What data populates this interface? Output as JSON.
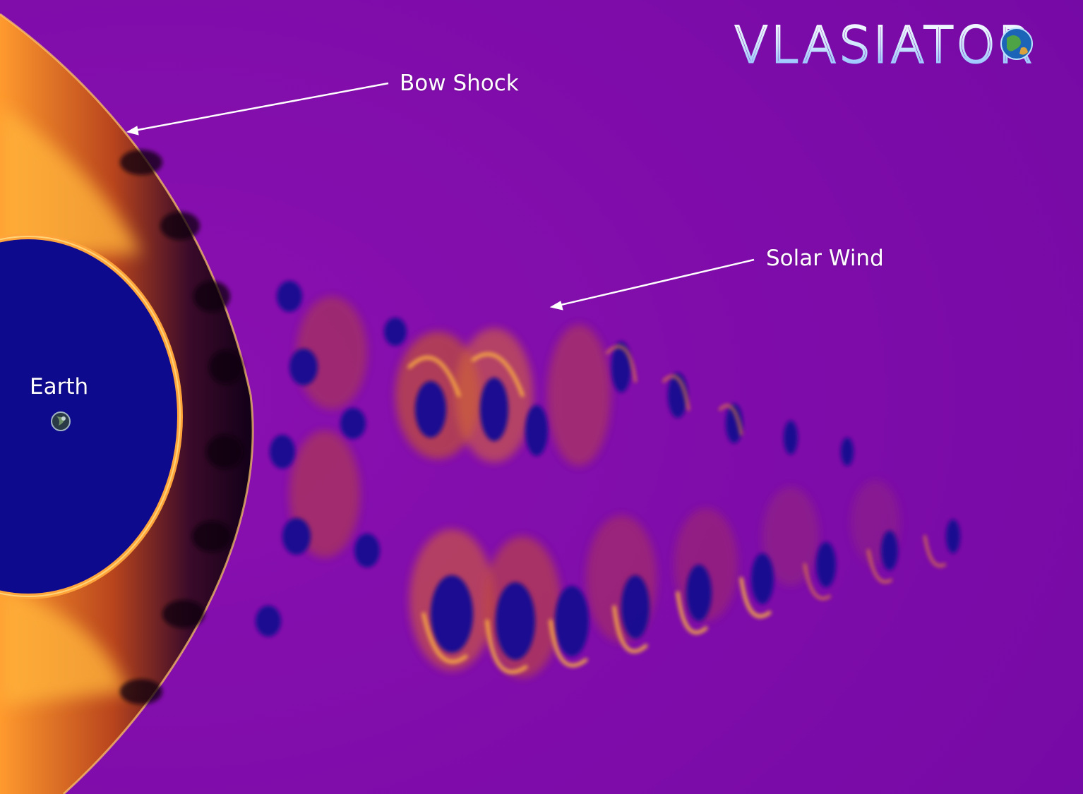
{
  "logo": {
    "text": "VLASIATOR",
    "icon": "globe-icon"
  },
  "annotations": {
    "bow_shock": "Bow Shock",
    "solar_wind": "Solar Wind",
    "earth": "Earth"
  },
  "colors": {
    "background": "#7a0aa6",
    "magnetosphere": "#0d0a8c",
    "sheath_dark": "#1a0020",
    "wave_bright": "#f4a530",
    "wave_hot": "#ff7a3a",
    "label": "#ffffff"
  },
  "icons": {
    "earth_marker": "earth-icon",
    "arrow": "arrow-icon"
  }
}
